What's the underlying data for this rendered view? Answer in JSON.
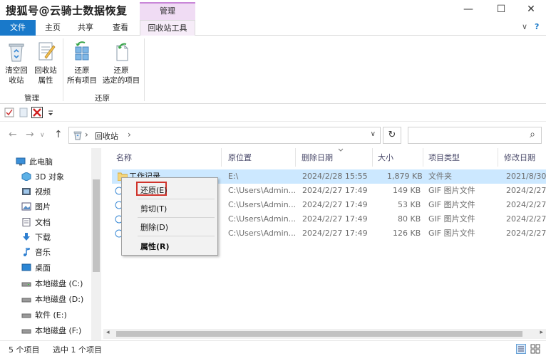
{
  "watermark": "搜狐号@云骑士数据恢复",
  "context_tab_head": "管理",
  "window_controls": {
    "minimize": "—",
    "maximize": "☐",
    "close": "✕"
  },
  "tabs": [
    {
      "label": "文件"
    },
    {
      "label": "主页"
    },
    {
      "label": "共享"
    },
    {
      "label": "查看"
    },
    {
      "label": "回收站工具"
    }
  ],
  "ribbon_right": {
    "collapse": "∨",
    "help": "?"
  },
  "ribbon": {
    "groups": [
      {
        "label": "管理",
        "buttons": [
          {
            "line1": "清空回",
            "line2": "收站"
          },
          {
            "line1": "回收站",
            "line2": "属性"
          }
        ]
      },
      {
        "label": "还原",
        "buttons": [
          {
            "line1": "还原",
            "line2": "所有项目"
          },
          {
            "line1": "还原",
            "line2": "选定的项目"
          }
        ]
      }
    ]
  },
  "address": {
    "path": "回收站",
    "chevron": "›",
    "refresh": "↻",
    "search_icon": "⌕",
    "dropdown": "∨"
  },
  "nav_buttons": {
    "back": "←",
    "forward": "→",
    "up": "↑",
    "dropdown": "∨"
  },
  "navpane": [
    {
      "label": "此电脑",
      "icon": "computer-icon"
    },
    {
      "label": "3D 对象",
      "icon": "cube-icon"
    },
    {
      "label": "视频",
      "icon": "video-icon"
    },
    {
      "label": "图片",
      "icon": "pictures-icon"
    },
    {
      "label": "文档",
      "icon": "documents-icon"
    },
    {
      "label": "下载",
      "icon": "download-icon"
    },
    {
      "label": "音乐",
      "icon": "music-icon"
    },
    {
      "label": "桌面",
      "icon": "desktop-icon"
    },
    {
      "label": "本地磁盘 (C:)",
      "icon": "drive-icon"
    },
    {
      "label": "本地磁盘 (D:)",
      "icon": "drive-icon"
    },
    {
      "label": "软件 (E:)",
      "icon": "drive-icon"
    },
    {
      "label": "本地磁盘 (F:)",
      "icon": "drive-icon"
    }
  ],
  "columns": [
    "名称",
    "原位置",
    "删除日期",
    "大小",
    "项目类型",
    "修改日期"
  ],
  "rows": [
    {
      "name": "工作记录",
      "location": "E:\\",
      "deleted": "2024/2/28 15:55",
      "size": "1,879 KB",
      "type": "文件夹",
      "modified": "2021/8/30"
    },
    {
      "name": "",
      "location": "C:\\Users\\Admin...",
      "deleted": "2024/2/27 17:49",
      "size": "149 KB",
      "type": "GIF 图片文件",
      "modified": "2024/2/27"
    },
    {
      "name": "",
      "location": "C:\\Users\\Admin...",
      "deleted": "2024/2/27 17:49",
      "size": "53 KB",
      "type": "GIF 图片文件",
      "modified": "2024/2/27"
    },
    {
      "name": "",
      "location": "C:\\Users\\Admin...",
      "deleted": "2024/2/27 17:49",
      "size": "80 KB",
      "type": "GIF 图片文件",
      "modified": "2024/2/27"
    },
    {
      "name": "",
      "location": "C:\\Users\\Admin...",
      "deleted": "2024/2/27 17:49",
      "size": "126 KB",
      "type": "GIF 图片文件",
      "modified": "2024/2/27"
    }
  ],
  "context_menu": {
    "restore": "还原(E)",
    "cut": "剪切(T)",
    "delete": "删除(D)",
    "properties": "属性(R)"
  },
  "status": {
    "count": "5 个项目",
    "selection": "选中 1 个项目"
  },
  "colors": {
    "file_tab": "#1979ca",
    "selection": "#cce8ff",
    "highlight_box": "#d0342c",
    "context_tab": "#f0dcf4"
  }
}
